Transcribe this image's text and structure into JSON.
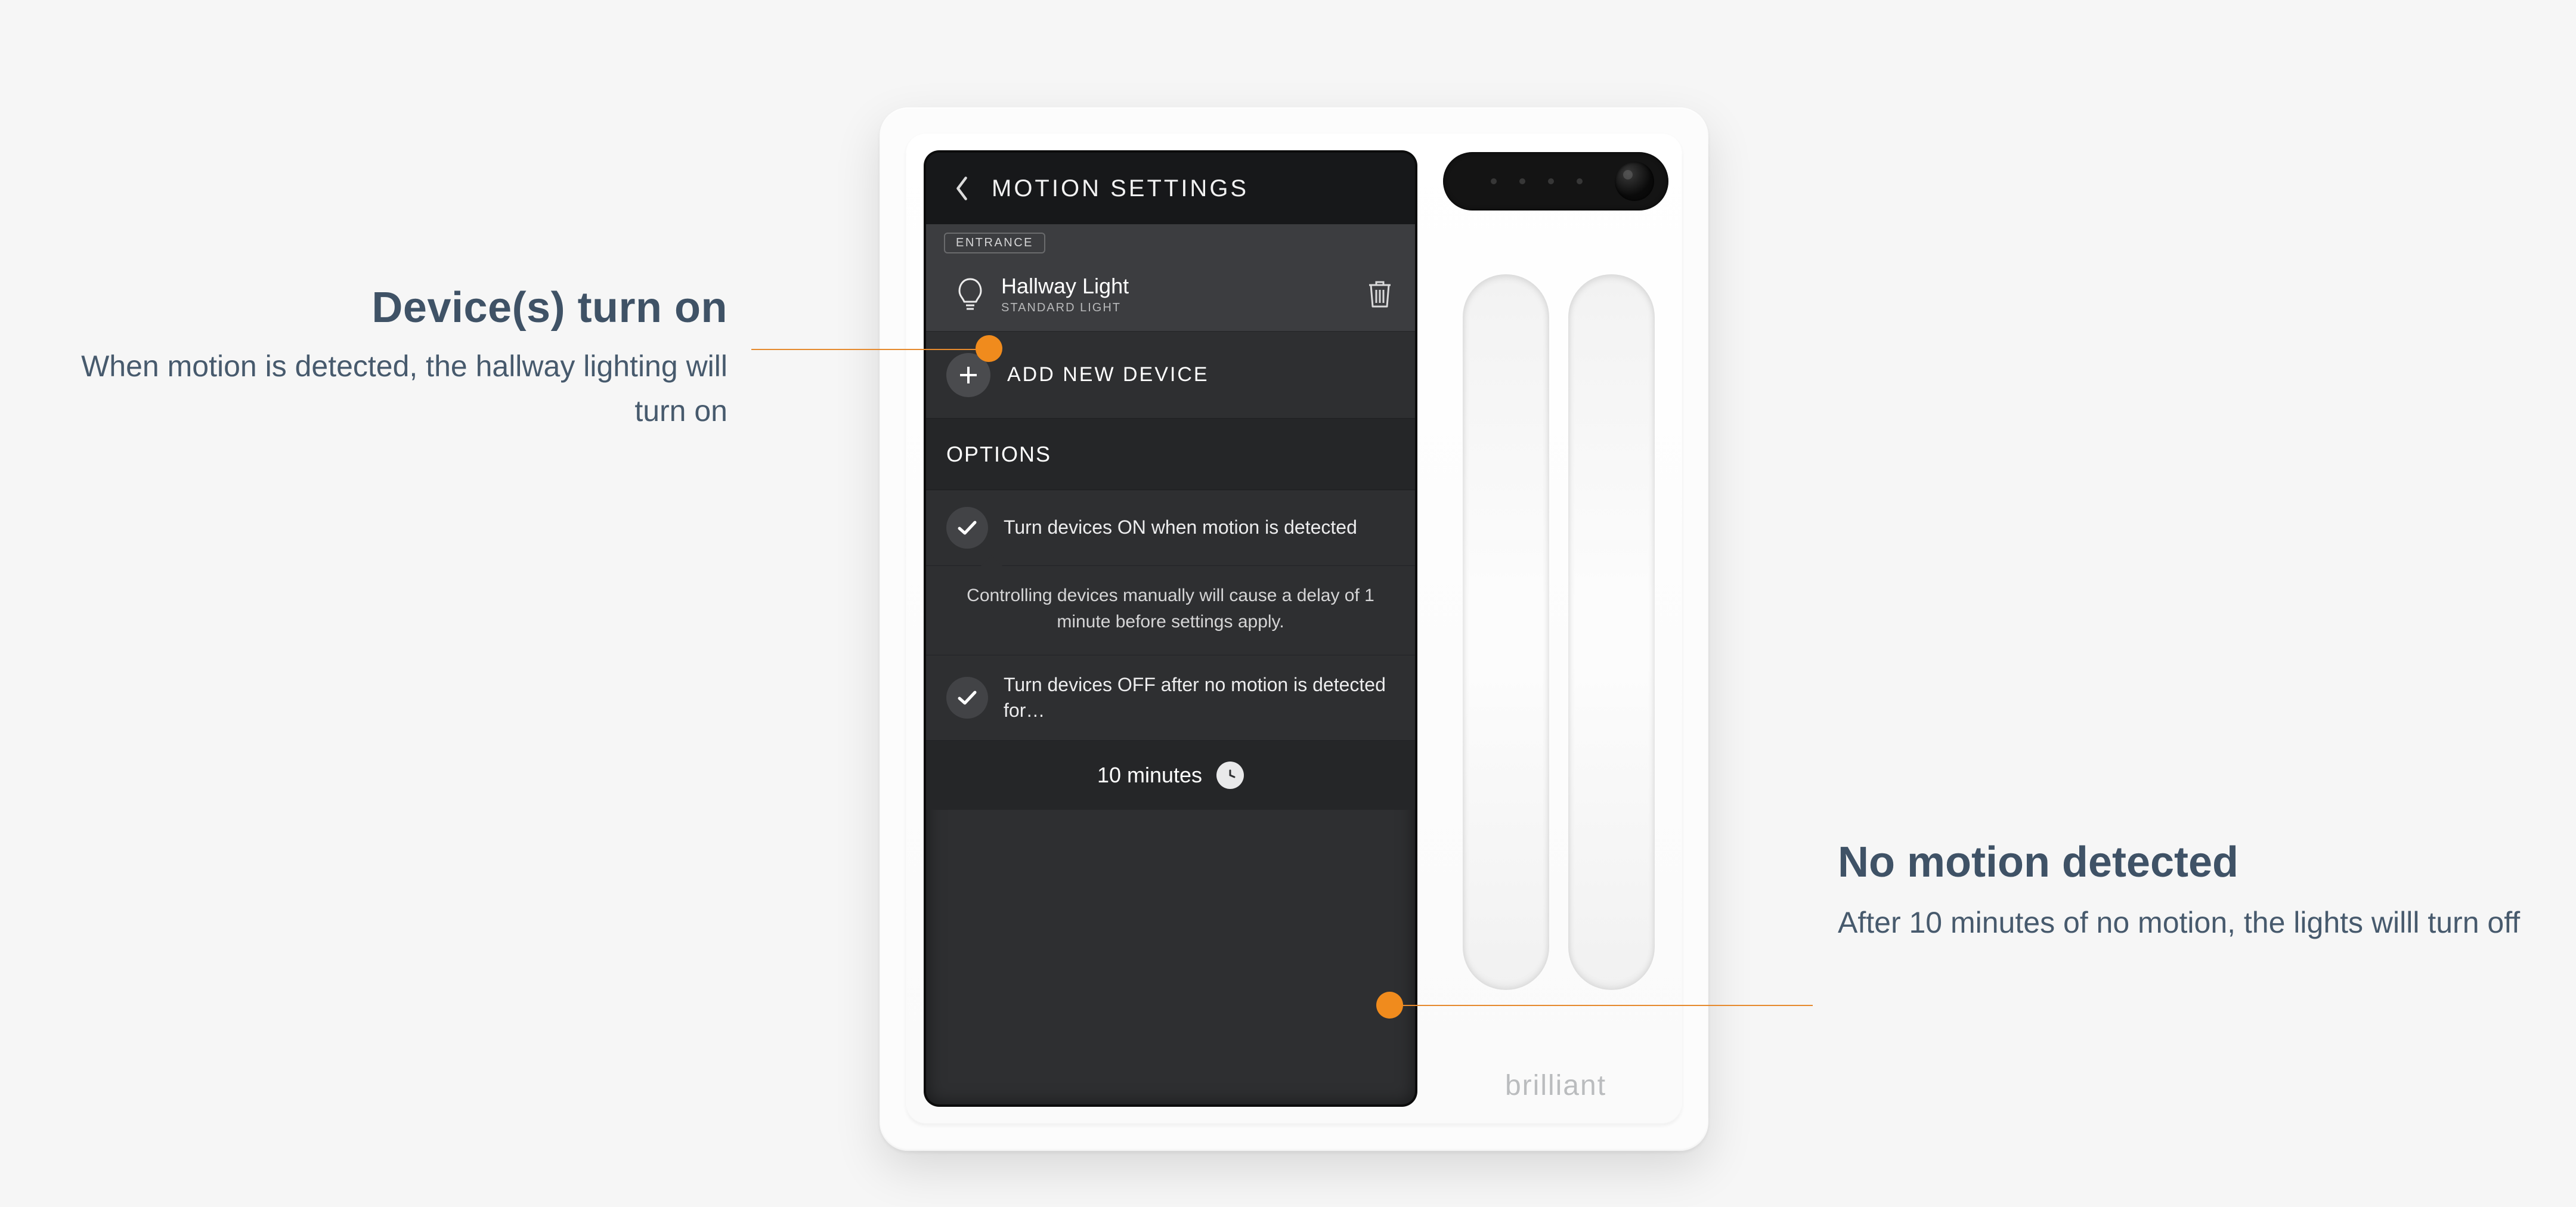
{
  "annotations": {
    "left": {
      "title": "Device(s) turn on",
      "desc": "When motion is detected, the hallway lighting will turn on"
    },
    "right": {
      "title": "No motion detected",
      "desc": "After 10 minutes of no motion, the lights willl turn off"
    }
  },
  "device": {
    "brand": "brilliant"
  },
  "screen": {
    "header_title": "MOTION SETTINGS",
    "room_chip": "ENTRANCE",
    "device_item": {
      "name": "Hallway Light",
      "type": "STANDARD LIGHT"
    },
    "add_device_label": "ADD NEW DEVICE",
    "options_header": "OPTIONS",
    "option_on": "Turn devices ON when motion is detected",
    "note": "Controlling devices manually will cause a delay of 1 minute before settings apply.",
    "option_off": "Turn devices OFF after no motion is detected for…",
    "timeout_label": "10 minutes"
  },
  "colors": {
    "accent_orange": "#f08b1d",
    "annotation_text": "#3f5266",
    "screen_bg": "#2e2f31"
  }
}
